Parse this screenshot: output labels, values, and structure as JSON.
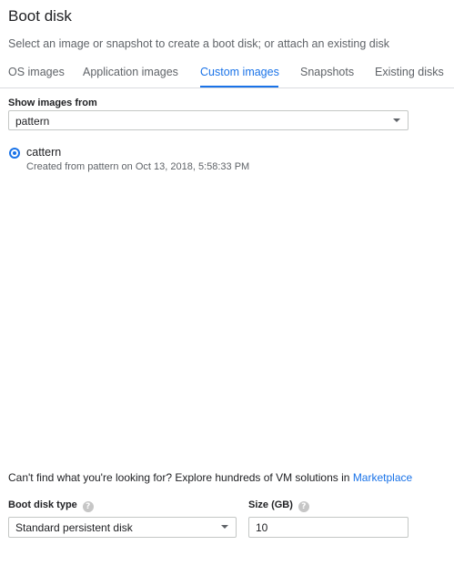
{
  "title": "Boot disk",
  "subtitle": "Select an image or snapshot to create a boot disk; or attach an existing disk",
  "tabs": [
    {
      "label": "OS images",
      "active": false
    },
    {
      "label": "Application images",
      "active": false
    },
    {
      "label": "Custom images",
      "active": true
    },
    {
      "label": "Snapshots",
      "active": false
    },
    {
      "label": "Existing disks",
      "active": false
    }
  ],
  "show_images_from": {
    "label": "Show images from",
    "value": "pattern"
  },
  "images": [
    {
      "name": "cattern",
      "description": "Created from pattern on Oct 13, 2018, 5:58:33 PM",
      "selected": true
    }
  ],
  "marketplace": {
    "text": "Can't find what you're looking for? Explore hundreds of VM solutions in",
    "link": "Marketplace"
  },
  "boot_disk_type": {
    "label": "Boot disk type",
    "value": "Standard persistent disk",
    "help_icon": "?"
  },
  "size": {
    "label": "Size (GB)",
    "value": "10",
    "help_icon": "?"
  },
  "colors": {
    "accent": "#1a73e8",
    "text": "#202124",
    "secondary_text": "#5f6368",
    "border": "#dadce0"
  }
}
